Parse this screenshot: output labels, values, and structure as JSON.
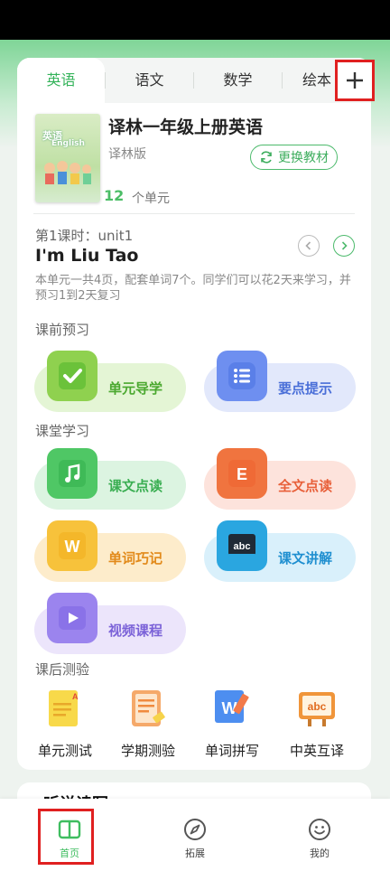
{
  "tabs": [
    "英语",
    "语文",
    "数学",
    "绘本"
  ],
  "active_tab": 0,
  "add_button": "+",
  "book": {
    "cover_title": "英语",
    "cover_subtitle": "English",
    "title": "译林一年级上册英语",
    "version": "译林版",
    "change_label": "更换教材",
    "unit_count": "12",
    "unit_label": "个单元"
  },
  "lesson": {
    "label": "第1课时：unit1",
    "title": "I'm Liu Tao",
    "description": "本单元一共4页，配套单词7个。同学们可以花2天来学习，并预习1到2天复习"
  },
  "sections": {
    "pre": "课前预习",
    "class": "课堂学习",
    "post": "课后测验"
  },
  "features": {
    "unit_guide": "单元导学",
    "key_points": "要点提示",
    "text_reading": "课文点读",
    "full_reading": "全文点读",
    "word_memory": "单词巧记",
    "text_explain": "课文讲解",
    "video_course": "视频课程"
  },
  "tests": [
    "单元测试",
    "学期测验",
    "单词拼写",
    "中英互译"
  ],
  "next_section": "听说读写",
  "bottom_nav": {
    "home": "首页",
    "expand": "拓展",
    "mine": "我的"
  },
  "colors": {
    "accent": "#34b35a",
    "highlight_box": "#e02020"
  }
}
